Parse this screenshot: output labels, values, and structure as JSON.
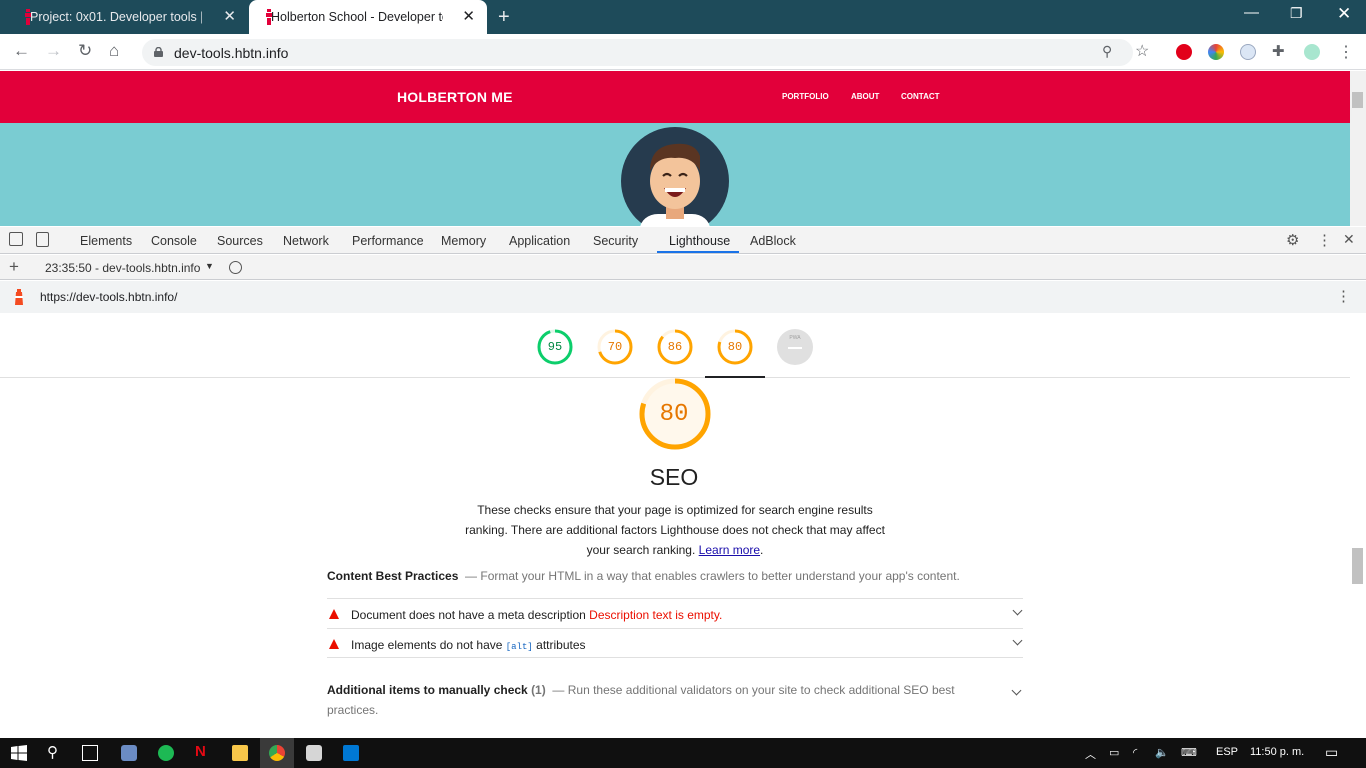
{
  "browser": {
    "tabs": [
      {
        "title": "Project: 0x01. Developer tools | H",
        "active": false
      },
      {
        "title": "Holberton School - Developer to",
        "active": true
      }
    ],
    "address": "dev-tools.hbtn.info"
  },
  "site": {
    "brand": "HOLBERTON ME",
    "nav": [
      "PORTFOLIO",
      "ABOUT",
      "CONTACT"
    ]
  },
  "devtools": {
    "tabs": [
      "Elements",
      "Console",
      "Sources",
      "Network",
      "Performance",
      "Memory",
      "Application",
      "Security",
      "Lighthouse",
      "AdBlock"
    ],
    "active_tab": "Lighthouse",
    "report_select": "23:35:50 - dev-tools.hbtn.info",
    "report_url": "https://dev-tools.hbtn.info/"
  },
  "lighthouse": {
    "scores": [
      {
        "value": "95",
        "score": 0.95,
        "color": "#0cce6b"
      },
      {
        "value": "70",
        "score": 0.7,
        "color": "#ffa400"
      },
      {
        "value": "86",
        "score": 0.86,
        "color": "#ffa400"
      },
      {
        "value": "80",
        "score": 0.8,
        "color": "#ffa400"
      },
      {
        "value": "PWA",
        "score": 0,
        "color": "#c6c6c6"
      }
    ],
    "seo_score": "80",
    "seo_title": "SEO",
    "seo_desc": "These checks ensure that your page is optimized for search engine results ranking. There are additional factors Lighthouse does not check that may affect your search ranking.",
    "learn_more": "Learn more",
    "group1_title": "Content Best Practices",
    "group1_desc": "Format your HTML in a way that enables crawlers to better understand your app's content.",
    "audit1_title": "Document does not have a meta description",
    "audit1_detail": "Description text is empty.",
    "audit2_pre": "Image elements do not have",
    "audit2_code": "[alt]",
    "audit2_post": "attributes",
    "group2_title": "Additional items to manually check",
    "group2_count": "(1)",
    "group2_desc": "Run these additional validators on your site to check additional SEO best practices."
  },
  "taskbar": {
    "lang": "ESP",
    "time": "11:50 p. m."
  }
}
